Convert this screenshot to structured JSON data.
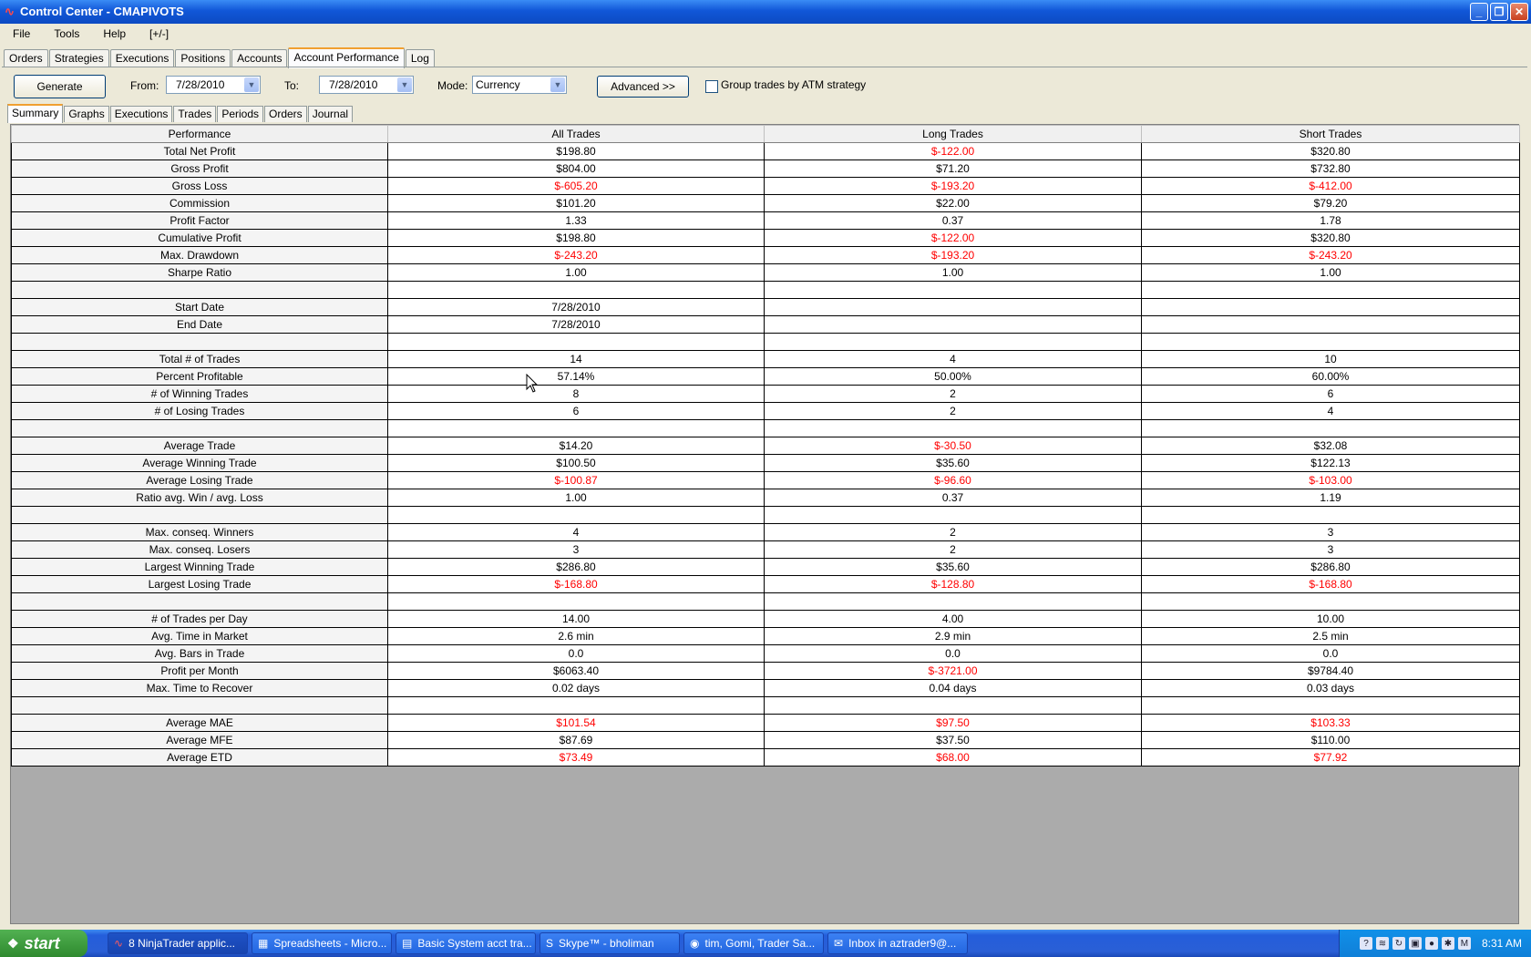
{
  "window": {
    "title": "Control Center - CMAPIVOTS",
    "minimize_glyph": "_",
    "maximize_glyph": "❐",
    "close_glyph": "✕"
  },
  "menu": [
    "File",
    "Tools",
    "Help",
    "[+/-]"
  ],
  "main_tabs": [
    "Orders",
    "Strategies",
    "Executions",
    "Positions",
    "Accounts",
    "Account Performance",
    "Log"
  ],
  "active_main_tab": "Account Performance",
  "toolbar": {
    "generate_label": "Generate",
    "from_label": "From:",
    "from_value": "7/28/2010",
    "to_label": "To:",
    "to_value": "7/28/2010",
    "mode_label": "Mode:",
    "mode_value": "Currency",
    "advanced_label": "Advanced >>",
    "group_label": "Group trades by ATM strategy"
  },
  "sub_tabs": [
    "Summary",
    "Graphs",
    "Executions",
    "Trades",
    "Periods",
    "Orders",
    "Journal"
  ],
  "active_sub_tab": "Summary",
  "table": {
    "headers": [
      "Performance",
      "All Trades",
      "Long Trades",
      "Short Trades"
    ],
    "rows": [
      [
        "Total Net Profit",
        "$198.80",
        "$-122.00",
        "$320.80"
      ],
      [
        "Gross Profit",
        "$804.00",
        "$71.20",
        "$732.80"
      ],
      [
        "Gross Loss",
        "$-605.20",
        "$-193.20",
        "$-412.00"
      ],
      [
        "Commission",
        "$101.20",
        "$22.00",
        "$79.20"
      ],
      [
        "Profit Factor",
        "1.33",
        "0.37",
        "1.78"
      ],
      [
        "Cumulative Profit",
        "$198.80",
        "$-122.00",
        "$320.80"
      ],
      [
        "Max. Drawdown",
        "$-243.20",
        "$-193.20",
        "$-243.20"
      ],
      [
        "Sharpe Ratio",
        "1.00",
        "1.00",
        "1.00"
      ],
      [
        "",
        "",
        "",
        ""
      ],
      [
        "Start Date",
        "7/28/2010",
        "",
        ""
      ],
      [
        "End Date",
        "7/28/2010",
        "",
        ""
      ],
      [
        "",
        "",
        "",
        ""
      ],
      [
        "Total # of Trades",
        "14",
        "4",
        "10"
      ],
      [
        "Percent Profitable",
        "57.14%",
        "50.00%",
        "60.00%"
      ],
      [
        "# of Winning Trades",
        "8",
        "2",
        "6"
      ],
      [
        "# of Losing Trades",
        "6",
        "2",
        "4"
      ],
      [
        "",
        "",
        "",
        ""
      ],
      [
        "Average Trade",
        "$14.20",
        "$-30.50",
        "$32.08"
      ],
      [
        "Average Winning Trade",
        "$100.50",
        "$35.60",
        "$122.13"
      ],
      [
        "Average Losing Trade",
        "$-100.87",
        "$-96.60",
        "$-103.00"
      ],
      [
        "Ratio avg. Win / avg. Loss",
        "1.00",
        "0.37",
        "1.19"
      ],
      [
        "",
        "",
        "",
        ""
      ],
      [
        "Max. conseq. Winners",
        "4",
        "2",
        "3"
      ],
      [
        "Max. conseq. Losers",
        "3",
        "2",
        "3"
      ],
      [
        "Largest Winning Trade",
        "$286.80",
        "$35.60",
        "$286.80"
      ],
      [
        "Largest Losing Trade",
        "$-168.80",
        "$-128.80",
        "$-168.80"
      ],
      [
        "",
        "",
        "",
        ""
      ],
      [
        "# of Trades per Day",
        "14.00",
        "4.00",
        "10.00"
      ],
      [
        "Avg. Time in Market",
        "2.6 min",
        "2.9 min",
        "2.5 min"
      ],
      [
        "Avg. Bars in Trade",
        "0.0",
        "0.0",
        "0.0"
      ],
      [
        "Profit per Month",
        "$6063.40",
        "$-3721.00",
        "$9784.40"
      ],
      [
        "Max. Time to Recover",
        "0.02 days",
        "0.04 days",
        "0.03 days"
      ],
      [
        "",
        "",
        "",
        ""
      ],
      [
        "Average MAE",
        "$101.54",
        "$97.50",
        "$103.33"
      ],
      [
        "Average MFE",
        "$87.69",
        "$37.50",
        "$110.00"
      ],
      [
        "Average ETD",
        "$73.49",
        "$68.00",
        "$77.92"
      ]
    ],
    "red_rows": [
      "Average MAE",
      "Average ETD"
    ],
    "negative_color": "#ff0000"
  },
  "taskbar": {
    "start_label": "start",
    "items": [
      {
        "icon": "ninjatrader-icon",
        "label": "8 NinjaTrader applic..."
      },
      {
        "icon": "spreadsheet-icon",
        "label": "Spreadsheets - Micro..."
      },
      {
        "icon": "excel-icon",
        "label": "Basic System acct tra..."
      },
      {
        "icon": "skype-icon",
        "label": "Skype™ - bholiman"
      },
      {
        "icon": "chat-icon",
        "label": "tim, Gomi, Trader Sa..."
      },
      {
        "icon": "mail-icon",
        "label": "Inbox in aztrader9@..."
      }
    ],
    "clock": "8:31 AM"
  }
}
